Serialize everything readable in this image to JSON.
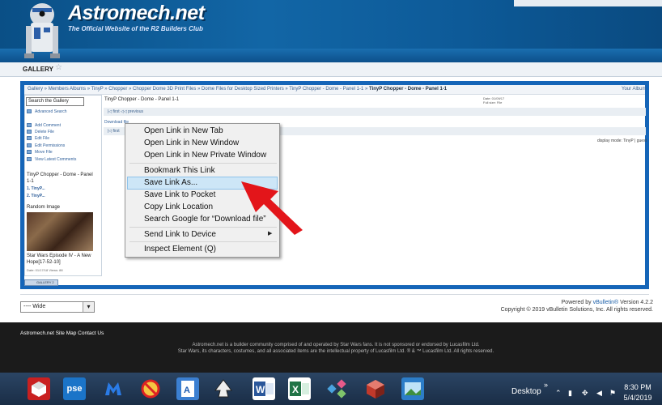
{
  "header": {
    "logo_text": "Astromech.net",
    "tagline": "The Official Website of the R2 Builders Club"
  },
  "navbar": {
    "gallery_label": "GALLERY"
  },
  "breadcrumb": {
    "items": [
      "Gallery",
      "Members Albums",
      "TinyP",
      "Chopper",
      "Chopper Dome 3D Print Files",
      "Dome Files for Desktop Sized Printers",
      "TinyP Chopper - Dome - Panel 1-1"
    ],
    "current": "TinyP Chopper - Dome - Panel 1-1",
    "your_album": "Your Album"
  },
  "sidebar": {
    "search_value": "Search the Gallery",
    "advanced_search": "Advanced Search",
    "actions": [
      "Add Comment",
      "Delete File",
      "Edit File",
      "Edit Permissions",
      "Move File",
      "View Latest Comments"
    ],
    "album_title": "TinyP Chopper - Dome - Panel 1-1",
    "album_items": [
      "1. TinyP...",
      "2. TinyP..."
    ],
    "random_image_title": "Random Image",
    "random_caption": "Star Wars Episode IV - A New Hope[17-52-10]",
    "random_meta": "Date: 01/17/18 Views: 88",
    "gallery_badge": "GALLERY 2"
  },
  "main": {
    "title": "TinyP Chopper - Dome - Panel 1-1",
    "date_info": "Date: 01/09/17",
    "size_info": "Full size: File",
    "pager_first": "first",
    "pager_previous": "previous",
    "download_link": "Download file",
    "display_mode": "display mode: TinyP | guest"
  },
  "context_menu": {
    "items": [
      "Open Link in New Tab",
      "Open Link in New Window",
      "Open Link in New Private Window",
      "Bookmark This Link",
      "Save Link As...",
      "Save Link to Pocket",
      "Copy Link Location",
      "Search Google for “Download file”",
      "Send Link to Device",
      "Inspect Element (Q)"
    ],
    "highlighted_index": 4,
    "highlight_color": "#cde6f7"
  },
  "footer": {
    "style_select": "---- Wide",
    "powered_by_prefix": "Powered by ",
    "powered_by_brand": "vBulletin®",
    "powered_by_version": " Version 4.2.2",
    "copyright": "Copyright © 2019 vBulletin Solutions, Inc. All rights reserved.",
    "links": "Astromech.net   Site Map   Contact Us",
    "disclaimer_line1": "Astromech.net is a builder community comprised of and operated by Star Wars fans. It is not sponsored or endorsed by Lucasfilm Ltd.",
    "disclaimer_line2": "Star Wars, its characters, costumes, and all associated items are the intellectual property of Lucasfilm Ltd. ® & ™ Lucasfilm Ltd. All rights reserved."
  },
  "taskbar": {
    "desktop_label": "Desktop",
    "time": "8:30 PM",
    "date": "5/4/2019",
    "apps": [
      "sketchup-icon",
      "pse-icon",
      "malwarebytes-icon",
      "blocked-icon",
      "word-viewer-icon",
      "inkscape-icon",
      "word-icon",
      "excel-icon",
      "network-icon",
      "3d-object-icon",
      "photo-viewer-icon"
    ]
  },
  "colors": {
    "header_blue": "#1266a6",
    "frame_blue": "#1565b8",
    "arrow_red": "#e3151a",
    "taskbar": "#1f3552"
  }
}
